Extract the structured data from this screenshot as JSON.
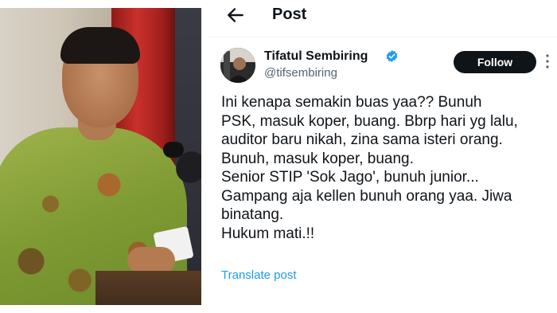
{
  "header": {
    "title": "Post",
    "back_icon": "back-arrow-icon"
  },
  "author": {
    "name": "Tifatul Sembiring",
    "handle": "@tifsembiring",
    "verified": true,
    "verified_color": "#1d9bf0",
    "verified_icon": "verified-badge-icon"
  },
  "follow_label": "Follow",
  "more_icon": "more-vertical-icon",
  "post": {
    "lines": [
      "Ini kenapa semakin buas yaa?? Bunuh",
      "PSK, masuk koper, buang. Bbrp hari yg lalu,",
      "auditor baru nikah, zina sama isteri orang.",
      "Bunuh, masuk koper, buang.",
      "Senior STIP 'Sok Jago', bunuh junior...",
      "Gampang aja kellen bunuh orang yaa. Jiwa",
      "binatang.",
      "Hukum mati.!!"
    ]
  },
  "translate_label": "Translate post",
  "colors": {
    "text": "#0f1419",
    "secondary": "#536471",
    "link": "#1d9bf0",
    "button_bg": "#0f1419",
    "button_text": "#ffffff"
  }
}
